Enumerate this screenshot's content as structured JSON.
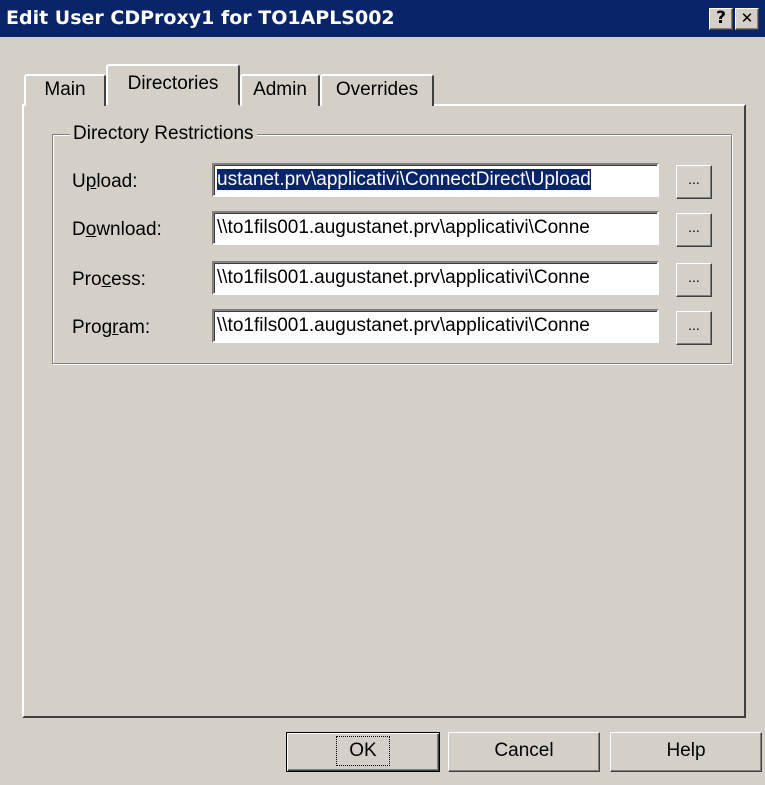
{
  "window": {
    "title": "Edit User CDProxy1 for TO1APLS002",
    "help_button": "?",
    "close_button": "✕"
  },
  "tabs": [
    {
      "label": "Main",
      "selected": false
    },
    {
      "label": "Directories",
      "selected": true
    },
    {
      "label": "Admin",
      "selected": false
    },
    {
      "label": "Overrides",
      "selected": false
    }
  ],
  "group": {
    "legend": "Directory Restrictions",
    "fields": [
      {
        "label_pre": "U",
        "label_accel": "p",
        "label_post": "load:",
        "value": "ustanet.prv\\applicativi\\ConnectDirect\\Upload",
        "selected": true,
        "browse": "..."
      },
      {
        "label_pre": "D",
        "label_accel": "o",
        "label_post": "wnload:",
        "value": "\\\\to1fils001.augustanet.prv\\applicativi\\Conne",
        "selected": false,
        "browse": "..."
      },
      {
        "label_pre": "Pro",
        "label_accel": "c",
        "label_post": "ess:",
        "value": "\\\\to1fils001.augustanet.prv\\applicativi\\Conne",
        "selected": false,
        "browse": "..."
      },
      {
        "label_pre": "Prog",
        "label_accel": "r",
        "label_post": "am:",
        "value": "\\\\to1fils001.augustanet.prv\\applicativi\\Conne",
        "selected": false,
        "browse": "..."
      }
    ]
  },
  "buttons": {
    "ok": "OK",
    "cancel": "Cancel",
    "help": "Help"
  }
}
